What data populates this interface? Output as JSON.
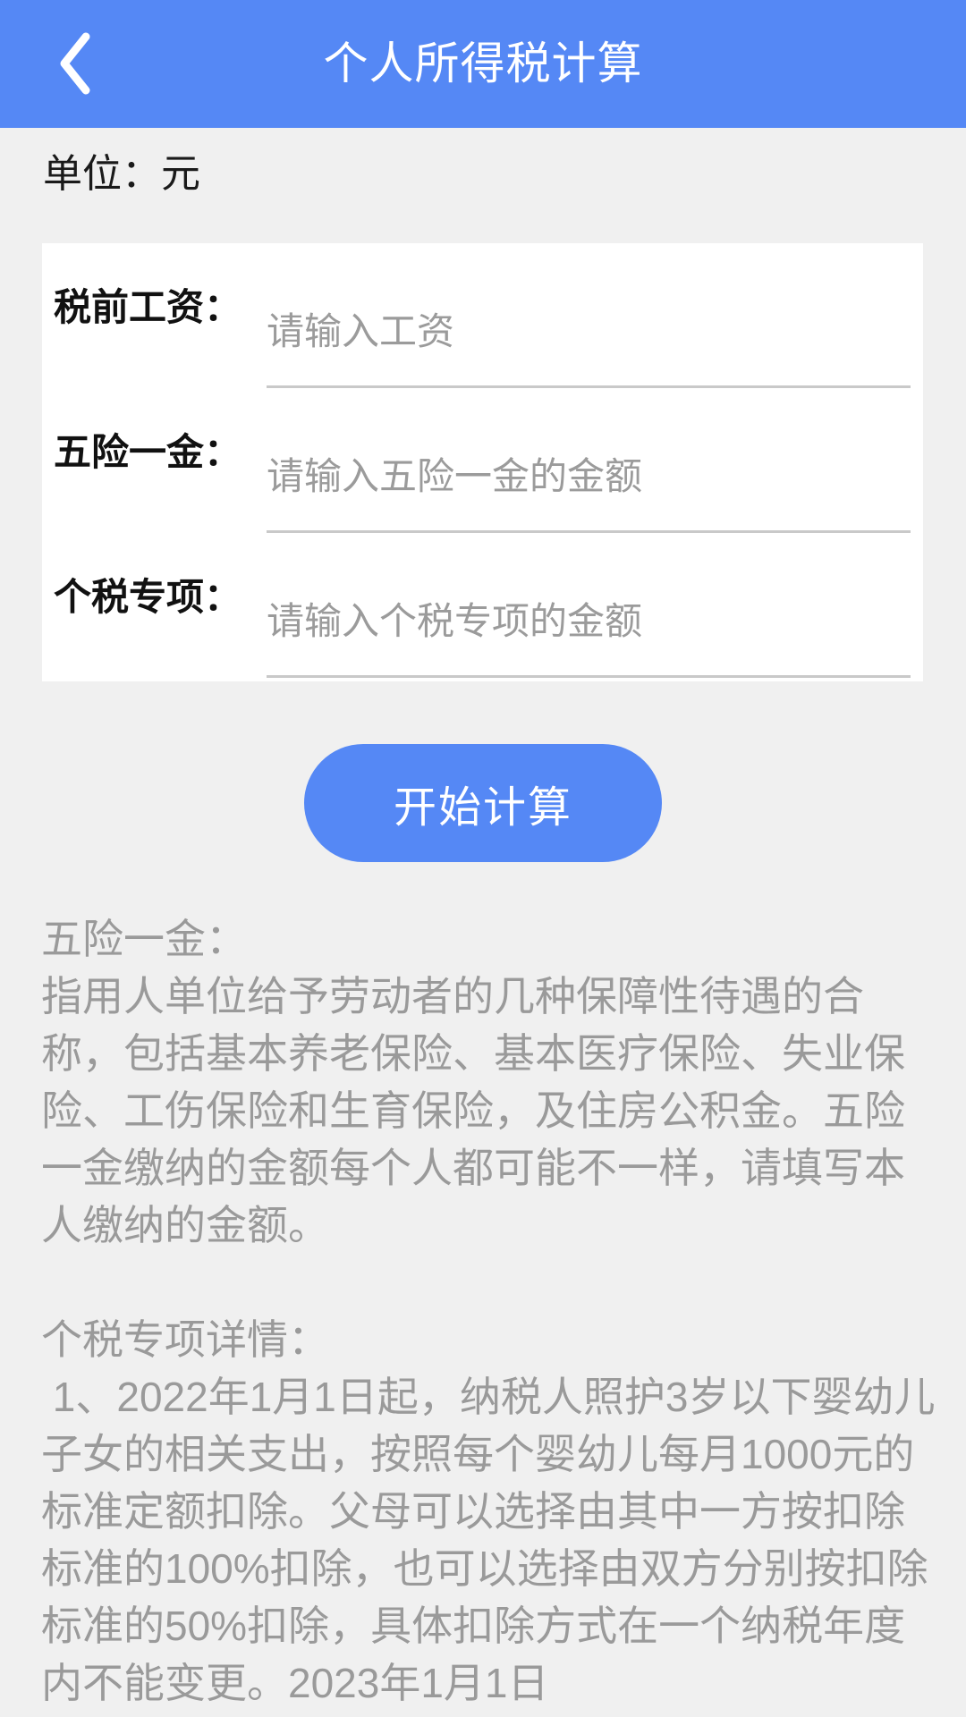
{
  "header": {
    "title": "个人所得税计算",
    "back_icon": "chevron-left-icon",
    "background_color": "#5588f5",
    "text_color": "#ffffff"
  },
  "unit": {
    "label": "单位：元"
  },
  "form": {
    "rows": [
      {
        "label": "税前工资：",
        "placeholder": "请输入工资",
        "value": ""
      },
      {
        "label": "五险一金：",
        "placeholder": "请输入五险一金的金额",
        "value": ""
      },
      {
        "label": "个税专项：",
        "placeholder": "请输入个税专项的金额",
        "value": ""
      }
    ]
  },
  "actions": {
    "calculate_label": "开始计算",
    "calculate_color": "#5588f5"
  },
  "info": {
    "paragraph1": "五险一金：\n指用人单位给予劳动者的几种保障性待遇的合称，包括基本养老保险、基本医疗保险、失业保险、工伤保险和生育保险，及住房公积金。五险一金缴纳的金额每个人都可能不一样，请填写本人缴纳的金额。",
    "paragraph2": "个税专项详情：\n 1、2022年1月1日起，纳税人照护3岁以下婴幼儿子女的相关支出，按照每个婴幼儿每月1000元的标准定额扣除。父母可以选择由其中一方按扣除标准的100%扣除，也可以选择由双方分别按扣除标准的50%扣除，具体扣除方式在一个纳税年度内不能变更。2023年1月1日",
    "text_color": "#9a9a9a"
  }
}
